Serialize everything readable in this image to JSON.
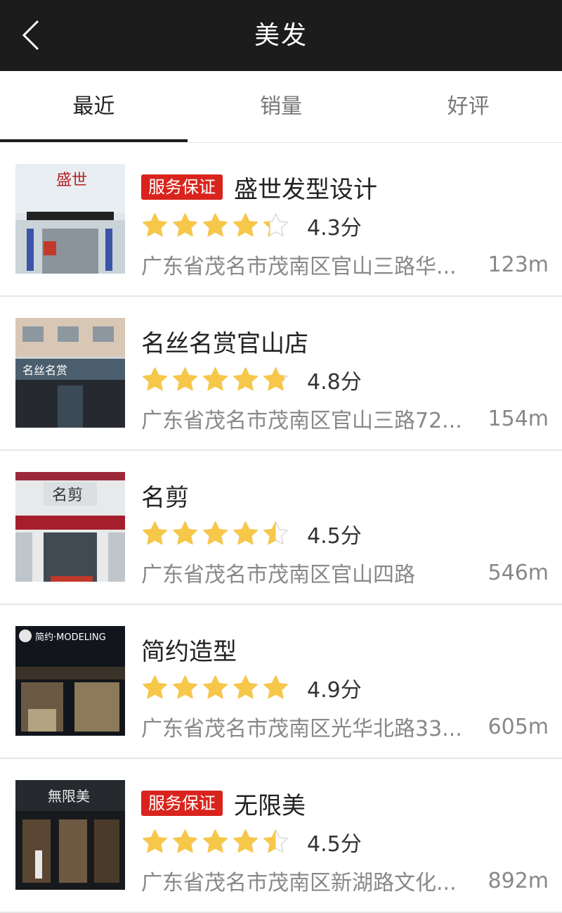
{
  "header": {
    "title": "美发"
  },
  "tabs": [
    {
      "label": "最近",
      "active": true
    },
    {
      "label": "销量",
      "active": false
    },
    {
      "label": "好评",
      "active": false
    }
  ],
  "colors": {
    "star_fill": "#f7c74a",
    "badge": "#d8241d",
    "header_bg": "#1c1c1c"
  },
  "shops": [
    {
      "badge": "服务保证",
      "name": "盛世发型设计",
      "rating": 4.3,
      "score_text": "4.3分",
      "address": "广东省茂名市茂南区官山三路华...",
      "distance": "123m",
      "thumb_sign": "盛世"
    },
    {
      "badge": "",
      "name": "名丝名赏官山店",
      "rating": 4.8,
      "score_text": "4.8分",
      "address": "广东省茂名市茂南区官山三路72...",
      "distance": "154m",
      "thumb_sign": "名丝名赏"
    },
    {
      "badge": "",
      "name": "名剪",
      "rating": 4.5,
      "score_text": "4.5分",
      "address": "广东省茂名市茂南区官山四路",
      "distance": "546m",
      "thumb_sign": "名剪"
    },
    {
      "badge": "",
      "name": "简约造型",
      "rating": 4.9,
      "score_text": "4.9分",
      "address": "广东省茂名市茂南区光华北路33...",
      "distance": "605m",
      "thumb_sign": "简约·MODELING"
    },
    {
      "badge": "服务保证",
      "name": "无限美",
      "rating": 4.5,
      "score_text": "4.5分",
      "address": "广东省茂名市茂南区新湖路文化...",
      "distance": "892m",
      "thumb_sign": "無限美"
    }
  ]
}
